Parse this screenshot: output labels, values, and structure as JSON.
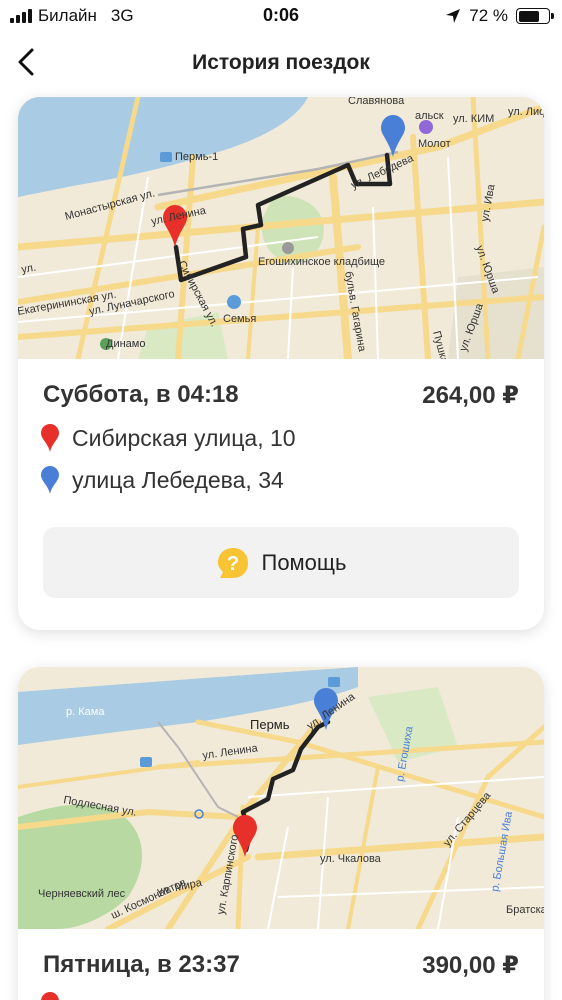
{
  "status_bar": {
    "carrier": "Билайн",
    "network": "3G",
    "time": "0:06",
    "battery_percent": "72 %",
    "battery_level": 0.72
  },
  "nav": {
    "title": "История поездок"
  },
  "trips": [
    {
      "date": "Суббота, в 04:18",
      "price": "264,00 ₽",
      "from": "Сибирская улица, 10",
      "to": "улица Лебедева, 34",
      "help_label": "Помощь",
      "map_labels": {
        "slavyanova": "Славянова",
        "kim": "ул. КИМ",
        "molot": "Молот",
        "lifan": "ул. Лифа",
        "perm1": "Пермь-1",
        "monastyrskaya": "Монастырская ул.",
        "lenina": "ул. Ленина",
        "ul": "ул.",
        "ekaterininskaya": "Екатерининская ул.",
        "lunacharskogo": "ул. Луначарского",
        "sibirskaya": "Сибирская ул.",
        "egoshikha": "Егошихинское кладбище",
        "bulvar": "бульв. Гагарина",
        "semya": "Семья",
        "dinamo": "Динамо",
        "iva": "ул. Ива",
        "yurshi": "ул. Юрша",
        "pushka": "Пушка",
        "yurshi2": "ул. Юрша",
        "lebedeva": "ул. Лебедева",
        "pervaya": "альск"
      }
    },
    {
      "date": "Пятница, в 23:37",
      "price": "390,00 ₽",
      "map_labels": {
        "kama": "р. Кама",
        "perm": "Пермь",
        "lenina": "ул. Ленина",
        "lenina2": "ул. Ленина",
        "podlesnaya": "Подлесная ул.",
        "chkalova": "ул. Чкалова",
        "karpinskogo": "ул. Карпинского",
        "mira": "ул. Мира",
        "kosmonavtov": "ш. Космонавтов",
        "chernyaevsky": "Черняевский лес",
        "egoshikha": "р. Егошиха",
        "startseva": "ул. Старцева",
        "bolshaya_iva": "р. Большая Ива",
        "bratska": "Братска"
      }
    }
  ],
  "colors": {
    "pin_from": "#e8302b",
    "pin_to": "#4a7fd8",
    "route": "#222222",
    "help_icon": "#f8c433",
    "water": "#a9cbe3",
    "road": "#f7d98c"
  }
}
